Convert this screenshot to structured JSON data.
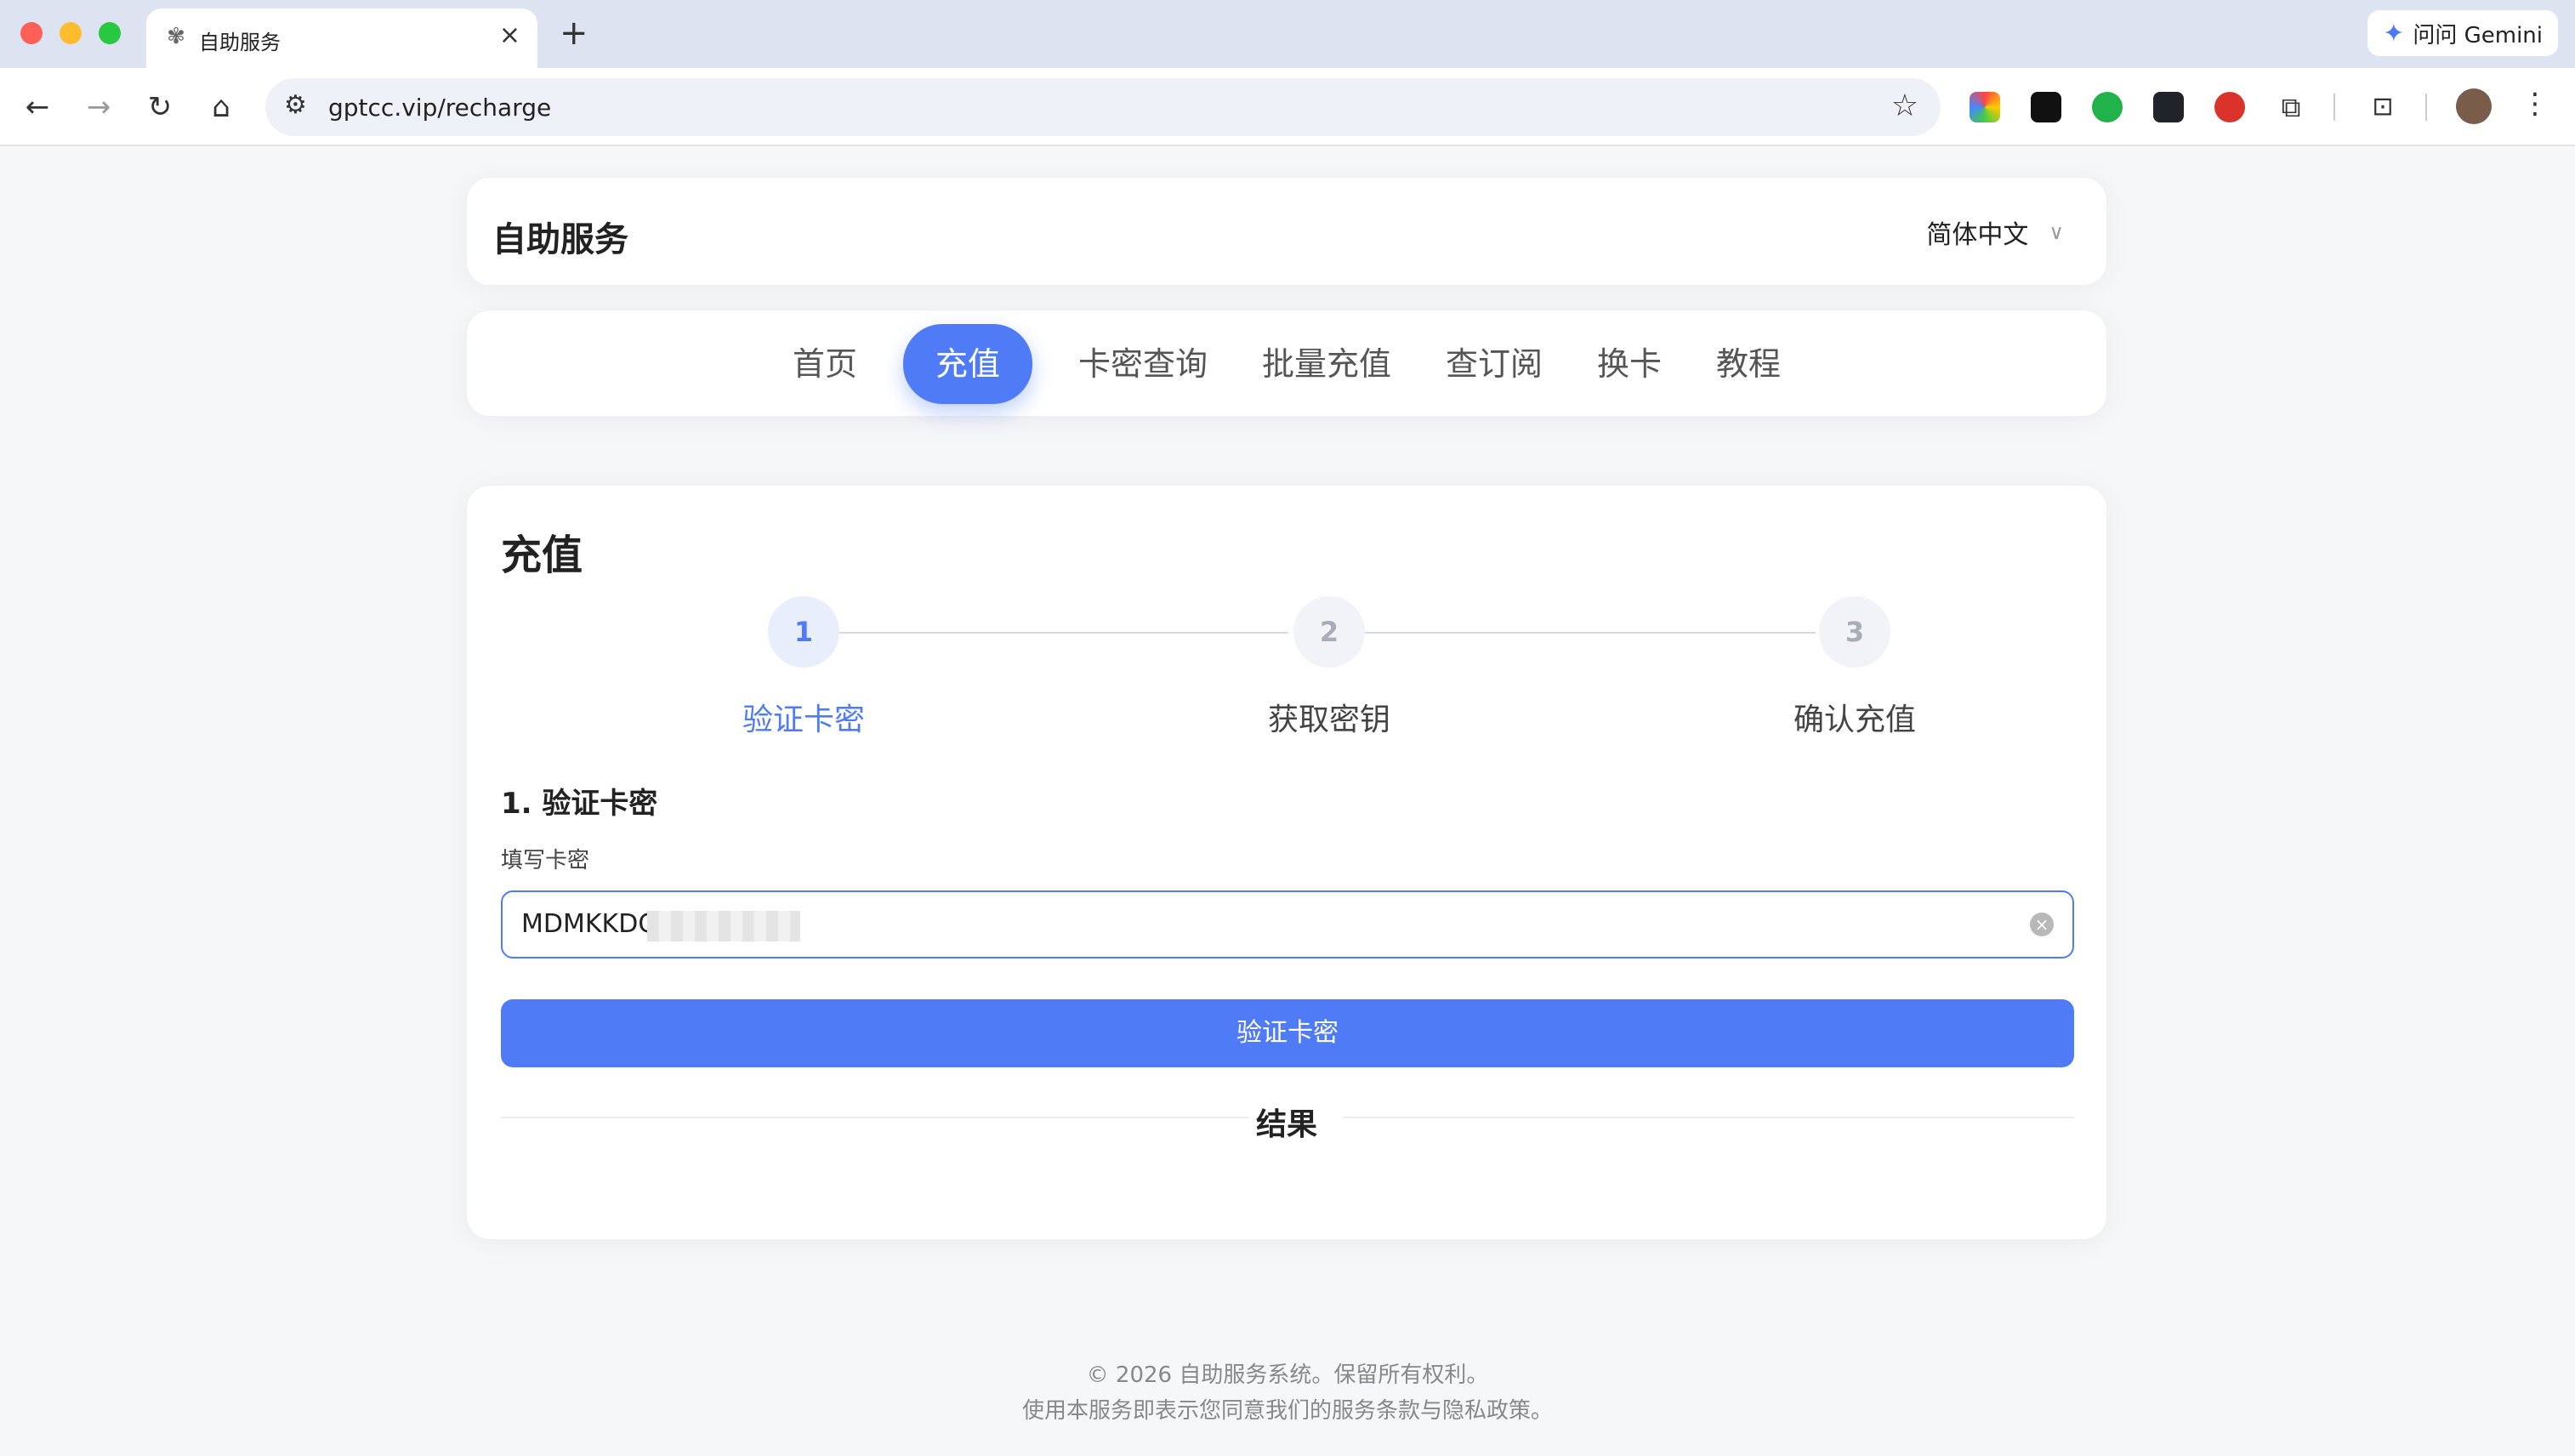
{
  "browser": {
    "tab_title": "自助服务",
    "gemini_label": "问问 Gemini",
    "url": "gptcc.vip/recharge"
  },
  "header": {
    "site_title": "自助服务",
    "language": "简体中文"
  },
  "nav": {
    "items": [
      "首页",
      "充值",
      "卡密查询",
      "批量充值",
      "查订阅",
      "换卡",
      "教程"
    ],
    "active_index": 1
  },
  "main": {
    "title": "充值",
    "steps": [
      {
        "number": "1",
        "label": "验证卡密",
        "state": "active"
      },
      {
        "number": "2",
        "label": "获取密钥",
        "state": "idle"
      },
      {
        "number": "3",
        "label": "确认充值",
        "state": "idle"
      }
    ],
    "step_title": "1. 验证卡密",
    "field_label": "填写卡密",
    "card_input_value": "MDMKKDG",
    "verify_button": "验证卡密",
    "result_label": "结果"
  },
  "footer": {
    "copyright": "© 2026 自助服务系统。保留所有权利。",
    "terms": "使用本服务即表示您同意我们的服务条款与隐私政策。"
  },
  "colors": {
    "accent": "#4f7cf6",
    "page_bg": "#f6f7f9"
  }
}
